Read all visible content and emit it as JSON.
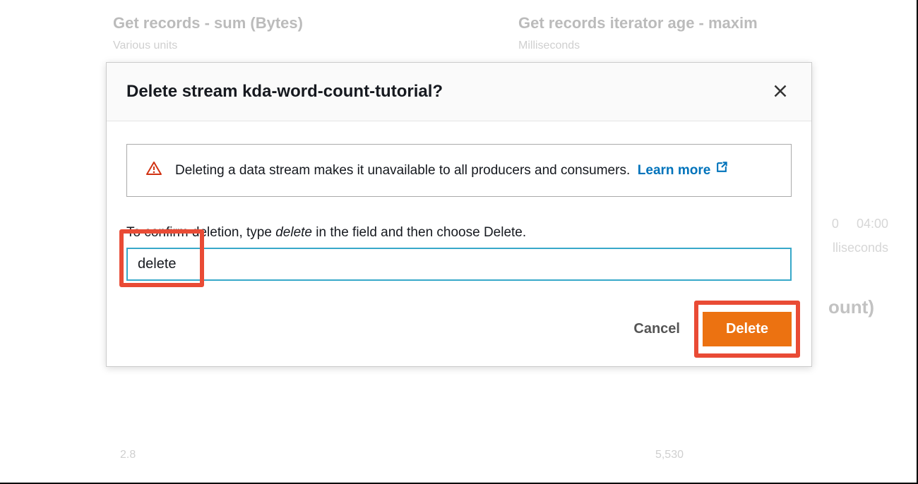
{
  "bg": {
    "card1_title": "Get records - sum (Bytes)",
    "card1_sub": "Various units",
    "card1_foot": "2.8",
    "card2_title": "Get records iterator age - maxim",
    "card2_sub": "Milliseconds",
    "card2_tick_a": "0",
    "card2_tick_b": "04:00",
    "card2_tick_unit": "lliseconds",
    "card2_big": "ount)",
    "card2_foot": "5,530"
  },
  "modal": {
    "title": "Delete stream kda-word-count-tutorial?",
    "warning_text": "Deleting a data stream makes it unavailable to all producers and consumers.",
    "learn_more": "Learn more",
    "confirm_prefix": "To confirm deletion, type ",
    "confirm_keyword": "delete",
    "confirm_suffix": " in the field and then choose Delete.",
    "input_value": "delete",
    "cancel": "Cancel",
    "delete": "Delete"
  }
}
